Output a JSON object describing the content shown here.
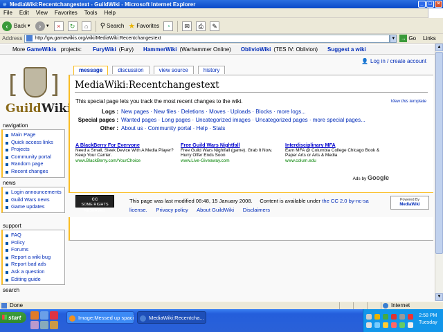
{
  "window": {
    "title": "MediaWiki:Recentchangestext - GuildWiki - Microsoft Internet Explorer",
    "icon": "internet-explorer-icon"
  },
  "menu": [
    "File",
    "Edit",
    "View",
    "Favorites",
    "Tools",
    "Help"
  ],
  "toolbar": {
    "back": "Back",
    "search": "Search",
    "favorites": "Favorites"
  },
  "address": {
    "label": "Address",
    "url": "http://gw.gamewikis.org/wiki/MediaWiki:Recentchangestext",
    "go": "Go",
    "links": "Links"
  },
  "gamewikis": {
    "lead": "More",
    "lead_link": "GameWikis",
    "lead_tail": "projects:",
    "projects": [
      {
        "name": "FuryWiki",
        "sub": "(Fury)"
      },
      {
        "name": "HammerWiki",
        "sub": "(Warhammer Online)"
      },
      {
        "name": "OblivioWiki",
        "sub": "(TES IV: Oblivion)"
      },
      {
        "name": "Suggest a wiki",
        "sub": ""
      }
    ]
  },
  "personal": {
    "login": "Log in / create account"
  },
  "logo": {
    "word1": "Guild",
    "word2": "Wiki"
  },
  "tabs": [
    "message",
    "discussion",
    "view source",
    "history"
  ],
  "sidebar": {
    "navigation": {
      "title": "navigation",
      "items": [
        "Main Page",
        "Quick access links",
        "Projects",
        "Community portal",
        "Random page",
        "Recent changes"
      ]
    },
    "news": {
      "title": "news",
      "items": [
        "Login announcements",
        "Guild Wars news",
        "Game updates"
      ]
    },
    "support": {
      "title": "support",
      "items": [
        "FAQ",
        "Policy",
        "Forums",
        "Report a wiki bug",
        "Report bad ads",
        "Ask a question",
        "Editing guide"
      ]
    },
    "search": {
      "title": "search"
    }
  },
  "page": {
    "title": "MediaWiki:Recentchangestext",
    "intro": "This special page lets you track the most recent changes to the wiki.",
    "view_template": "View this template",
    "rows": [
      {
        "key": "Logs :",
        "value": "New pages · New files · Deletions · Moves · Uploads · Blocks · more logs..."
      },
      {
        "key": "Special pages :",
        "value": "Wanted pages · Long pages · Uncategorized images · Uncategorized pages · more special pages..."
      },
      {
        "key": "Other :",
        "value": "About us · Community portal · Help · Stats"
      }
    ]
  },
  "ads": [
    {
      "title": "A BlackBerry For Everyone",
      "body": "Need a Small, Sleek Device With A Media Player? Keep Your Carrier.",
      "url": "www.BlackBerry.com/YourChoice"
    },
    {
      "title": "Free Guild Wars Nightfall",
      "body": "Free Guild Wars Nightfall (game). Grab It Now. Hurry Offer Ends Soon",
      "url": "www.Live-Giveaway.com"
    },
    {
      "title": "Interdisciplinary MFA",
      "body": "Earn MFA @ Columbia College Chicago Book & Paper Arts or Arts & Media",
      "url": "www.colum.edu"
    }
  ],
  "ads_by": {
    "prefix": "Ads by",
    "brand": "Google"
  },
  "footer": {
    "cc_badge_1": "cc",
    "cc_badge_2": "SOME RIGHTS RESERVED",
    "last_modified": "This page was last modified 08:48, 15 January 2008.",
    "license_pre": "Content is available under",
    "license_link": "the CC 2.0 by-nc-sa license.",
    "privacy": "Privacy policy",
    "about": "About GuildWiki",
    "disclaimers": "Disclaimers",
    "powered_1": "Powered By",
    "powered_2": "MediaWiki"
  },
  "status": {
    "text": "Done",
    "zone": "Internet"
  },
  "taskbar": {
    "start": "start",
    "tasks": [
      "Image:Messed up spacin...",
      "MediaWiki:Recentcha..."
    ],
    "time": "2:58 PM",
    "day": "Tuesday"
  },
  "colors": {
    "accent": "#fabd23",
    "link": "#002bb8",
    "xp_blue": "#245edb"
  }
}
